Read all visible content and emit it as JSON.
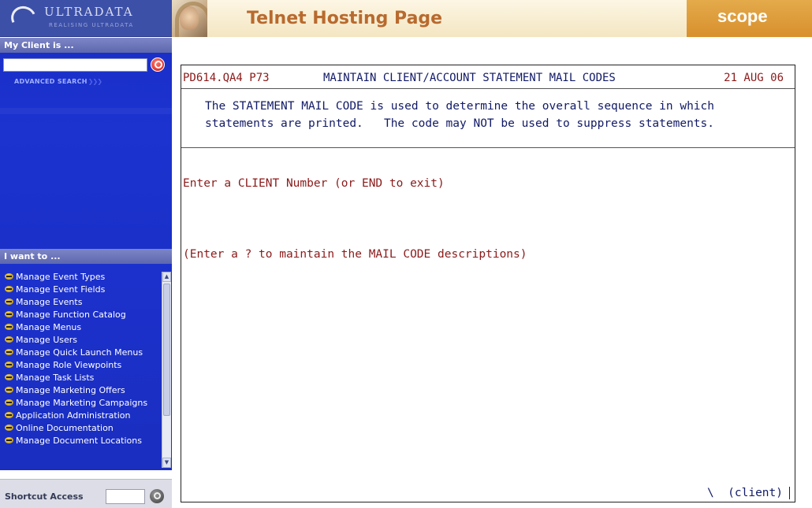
{
  "sidebar": {
    "logo_text": "ULTRADATA",
    "logo_subtext": "REALISING ULTRADATA",
    "client_heading": "My Client is ...",
    "search_value": "",
    "advanced_search_label": "ADVANCED SEARCH",
    "advanced_search_chevrons": "❯❯❯",
    "iwant_heading": "I want to ...",
    "menu_items": [
      {
        "label": "Manage Event Types"
      },
      {
        "label": "Manage Event Fields"
      },
      {
        "label": "Manage Events"
      },
      {
        "label": "Manage Function Catalog"
      },
      {
        "label": "Manage Menus"
      },
      {
        "label": "Manage Users"
      },
      {
        "label": "Manage Quick Launch Menus"
      },
      {
        "label": "Manage Role Viewpoints"
      },
      {
        "label": "Manage Task Lists"
      },
      {
        "label": "Manage Marketing Offers"
      },
      {
        "label": "Manage Marketing Campaigns"
      },
      {
        "label": "Application Administration"
      },
      {
        "label": "Online Documentation"
      },
      {
        "label": "Manage Document Locations"
      }
    ],
    "shortcut_label": "Shortcut Access",
    "shortcut_value": ""
  },
  "header": {
    "title": "Telnet Hosting Page",
    "brand": "scope"
  },
  "terminal": {
    "screen_id": "PD614.QA4 P73",
    "screen_title": "MAINTAIN CLIENT/ACCOUNT STATEMENT MAIL CODES",
    "date": "21 AUG 06",
    "info_line_1": "The STATEMENT MAIL CODE is used to determine the overall sequence in which",
    "info_line_2": "statements are printed.   The code may NOT be used to suppress statements.",
    "prompt_1": "Enter a CLIENT Number (or END to exit)",
    "prompt_2": "(Enter a ? to maintain the MAIL CODE descriptions)",
    "status": "\\  (client)"
  },
  "colors": {
    "sidebar_blue": "#1a2fc8",
    "header_tan": "#f4e6c2",
    "title_orange": "#b86a2e",
    "brand_orange": "#d8902c",
    "terminal_red": "#8b1a1a",
    "terminal_navy": "#111a66"
  },
  "icons": {
    "search": "search-icon",
    "menu_item": "arrow-bullet-icon",
    "shortcut": "go-icon"
  }
}
